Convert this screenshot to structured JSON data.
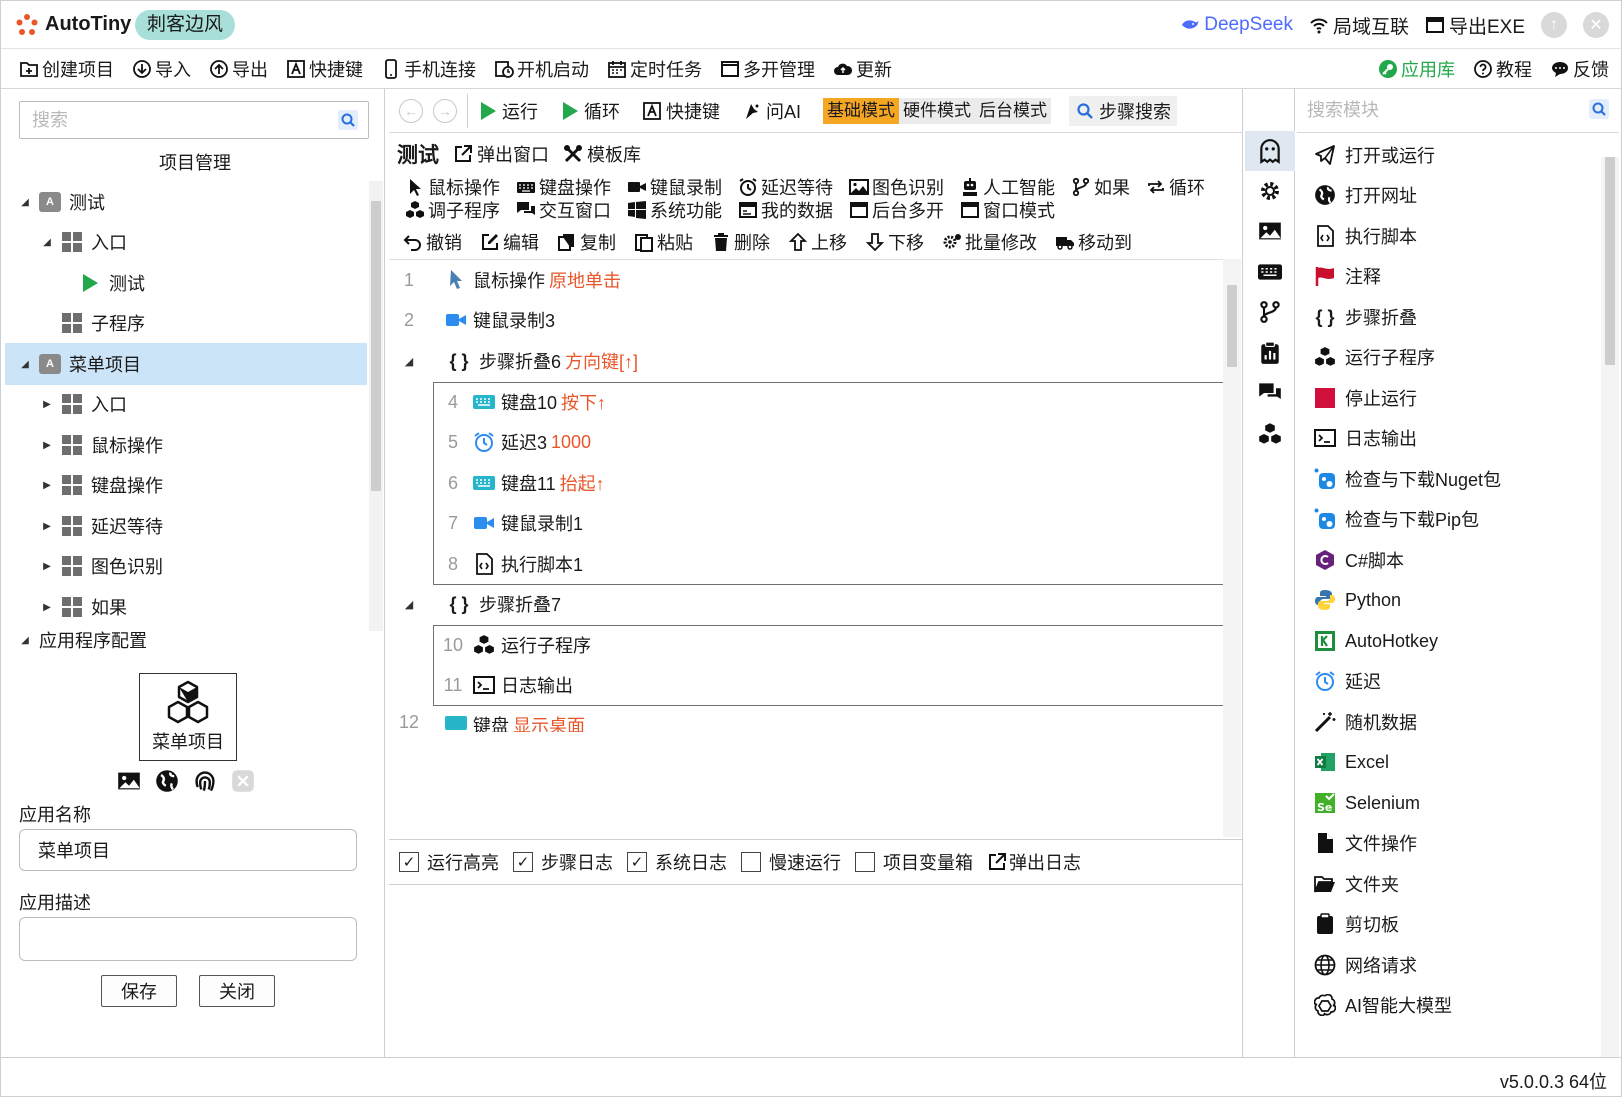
{
  "titlebar": {
    "app_name": "AutoTiny",
    "badge": "刺客边风",
    "deepseek": "DeepSeek",
    "lan": "局域互联",
    "export_exe": "导出EXE"
  },
  "menubar": {
    "items": [
      "创建项目",
      "导入",
      "导出",
      "快捷键",
      "手机连接",
      "开机启动",
      "定时任务",
      "多开管理",
      "更新"
    ],
    "right": [
      "应用库",
      "教程",
      "反馈"
    ]
  },
  "left": {
    "search_placeholder": "搜索",
    "project_title": "项目管理",
    "tree": [
      {
        "label": "测试",
        "kind": "project"
      },
      {
        "label": "入口",
        "kind": "module"
      },
      {
        "label": "测试",
        "kind": "run"
      },
      {
        "label": "子程序",
        "kind": "module"
      },
      {
        "label": "菜单项目",
        "kind": "project"
      },
      {
        "label": "入口",
        "kind": "module"
      },
      {
        "label": "鼠标操作",
        "kind": "module"
      },
      {
        "label": "键盘操作",
        "kind": "module"
      },
      {
        "label": "延迟等待",
        "kind": "module"
      },
      {
        "label": "图色识别",
        "kind": "module"
      },
      {
        "label": "如果",
        "kind": "module"
      }
    ],
    "app_config_title": "应用程序配置",
    "app_box_label": "菜单项目",
    "app_name_label": "应用名称",
    "app_name_value": "菜单项目",
    "app_desc_label": "应用描述",
    "app_desc_value": "",
    "save": "保存",
    "close": "关闭"
  },
  "center": {
    "toolbar": {
      "run": "运行",
      "loop": "循环",
      "hotkey": "快捷键",
      "ask_ai": "问AI",
      "modes": [
        "基础模式",
        "硬件模式",
        "后台模式"
      ],
      "step_search": "步骤搜索"
    },
    "title": "测试",
    "popup": "弹出窗口",
    "templates": "模板库",
    "categories_row1": [
      "鼠标操作",
      "键盘操作",
      "键鼠录制",
      "延迟等待",
      "图色识别",
      "人工智能",
      "如果",
      "循环"
    ],
    "categories_row2": [
      "调子程序",
      "交互窗口",
      "系统功能",
      "我的数据",
      "后台多开",
      "窗口模式"
    ],
    "edits": [
      "撤销",
      "编辑",
      "复制",
      "粘贴",
      "删除",
      "上移",
      "下移",
      "批量修改",
      "移动到"
    ],
    "steps": [
      {
        "num": "1",
        "name": "鼠标操作",
        "param": "原地单击"
      },
      {
        "num": "2",
        "name": "键鼠录制3",
        "param": ""
      },
      {
        "num": "",
        "name": "步骤折叠6",
        "param": "方向键[↑]"
      },
      {
        "num": "4",
        "name": "键盘10",
        "param": "按下↑"
      },
      {
        "num": "5",
        "name": "延迟3",
        "param": "1000"
      },
      {
        "num": "6",
        "name": "键盘11",
        "param": "抬起↑"
      },
      {
        "num": "7",
        "name": "键鼠录制1",
        "param": ""
      },
      {
        "num": "8",
        "name": "执行脚本1",
        "param": ""
      },
      {
        "num": "",
        "name": "步骤折叠7",
        "param": ""
      },
      {
        "num": "10",
        "name": "运行子程序",
        "param": ""
      },
      {
        "num": "11",
        "name": "日志输出",
        "param": ""
      },
      {
        "num": "12",
        "name": "键盘",
        "param": "显示桌面"
      }
    ],
    "checkboxes": [
      {
        "label": "运行高亮",
        "checked": true
      },
      {
        "label": "步骤日志",
        "checked": true
      },
      {
        "label": "系统日志",
        "checked": true
      },
      {
        "label": "慢速运行",
        "checked": false
      },
      {
        "label": "项目变量箱",
        "checked": false
      }
    ],
    "popup_log": "弹出日志"
  },
  "right": {
    "search_placeholder": "搜索模块",
    "modules": [
      "打开或运行",
      "打开网址",
      "执行脚本",
      "注释",
      "步骤折叠",
      "运行子程序",
      "停止运行",
      "日志输出",
      "检查与下载Nuget包",
      "检查与下载Pip包",
      "C#脚本",
      "Python",
      "AutoHotkey",
      "延迟",
      "随机数据",
      "Excel",
      "Selenium",
      "文件操作",
      "文件夹",
      "剪切板",
      "网络请求",
      "AI智能大模型"
    ]
  },
  "status": {
    "version": "v5.0.0.3 64位"
  },
  "colors": {
    "accent_green": "#22a84a",
    "param_orange": "#e8562a",
    "mode_active": "#f5a623",
    "selection": "#cce4f7",
    "badge": "#a8dfd8"
  }
}
